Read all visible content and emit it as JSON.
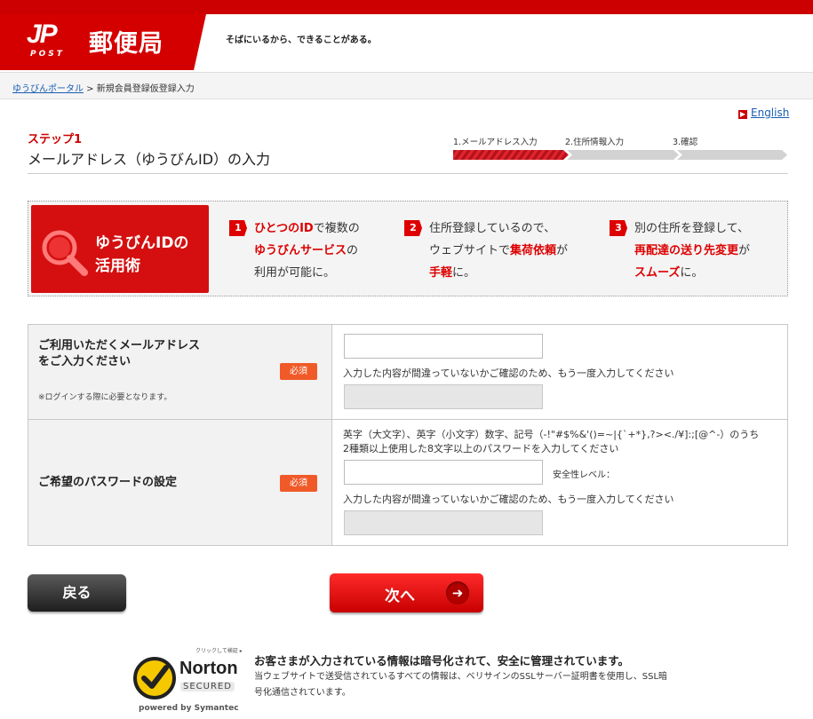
{
  "header": {
    "logo_mark": "JP",
    "logo_post": "POST",
    "logo_name": "郵便局",
    "tagline": "そばにいるから、できることがある。"
  },
  "breadcrumb": {
    "home_link": "ゆうびんポータル",
    "separator": " > ",
    "current": "新規会員登録仮登録入力"
  },
  "english_link": "English",
  "step": {
    "label": "ステップ1",
    "title": "メールアドレス（ゆうびんID）の入力"
  },
  "progress": {
    "steps": [
      "1.メールアドレス入力",
      "2.住所情報入力",
      "3.確認"
    ],
    "current": 1
  },
  "banner": {
    "title_line1": "ゆうびんIDの",
    "title_line2": "活用術",
    "points": [
      {
        "num": "1",
        "l1_red": "ひとつのID",
        "l1_rest": "で複数の",
        "l2_red": "ゆうびんサービス",
        "l2_rest": "の",
        "l3": "利用が可能に。"
      },
      {
        "num": "2",
        "l1": "住所登録しているので、",
        "l2_pre": "ウェブサイトで",
        "l2_red": "集荷依頼",
        "l2_rest": "が",
        "l3_red": "手軽",
        "l3_rest": "に。"
      },
      {
        "num": "3",
        "l1": "別の住所を登録して、",
        "l2_red": "再配達の送り先変更",
        "l2_rest": "が",
        "l3_red": "スムーズ",
        "l3_rest": "に。"
      }
    ]
  },
  "form": {
    "email": {
      "label_line1": "ご利用いただくメールアドレス",
      "label_line2": "をご入力ください",
      "note": "※ログインする際に必要となります。",
      "required": "必須",
      "value": "",
      "confirm_hint": "入力した内容が間違っていないかご確認のため、もう一度入力してください",
      "confirm_value": ""
    },
    "password": {
      "label": "ご希望のパスワードの設定",
      "required": "必須",
      "rule_line1": "英字（大文字）、英字（小文字）数字、記号（-!\"#$%&'()=~|{`+*},?><./¥]:;[@^-）のうち",
      "rule_line2": "2種類以上使用した8文字以上のパスワードを入力してください",
      "value": "",
      "strength_label": "安全性レベル：",
      "confirm_hint": "入力した内容が間違っていないかご確認のため、もう一度入力してください",
      "confirm_value": ""
    }
  },
  "buttons": {
    "back": "戻る",
    "next": "次へ",
    "next_icon": "➜"
  },
  "security": {
    "norton_click": "クリックして検証 ▸",
    "norton_name": "Norton",
    "norton_secured": "SECURED",
    "norton_powered": "powered by Symantec",
    "title": "お客さまが入力されている情報は暗号化されて、安全に管理されています。",
    "body": "当ウェブサイトで送受信されているすべての情報は、ベリサインのSSLサーバー証明書を使用し、SSL暗号化通信されています。"
  },
  "colors": {
    "brand_red": "#cc0000",
    "required_orange": "#f05a28",
    "link_blue": "#1a5db3"
  }
}
